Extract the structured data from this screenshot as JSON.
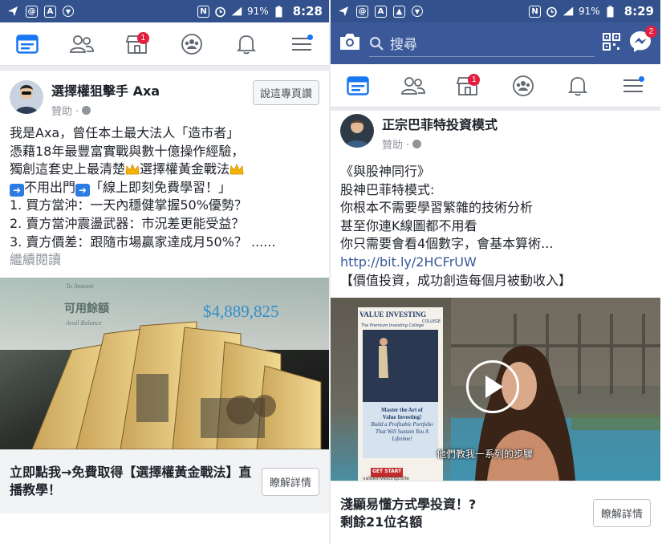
{
  "left": {
    "status": {
      "time": "8:28",
      "battery": "91%",
      "network": "4G"
    },
    "nav": {
      "notifications_badge": "1"
    },
    "post": {
      "page_name": "選擇權狙擊手 Axa",
      "sponsored": "贊助 · ",
      "like_button": "說這專頁讚",
      "lines": [
        "我是Axa，曾任本土最大法人「造市者」",
        "憑藉18年最豐富實戰與數十億操作經驗，",
        "獨創這套史上最清楚",
        "選擇權黃金戰法",
        "不用出門",
        "「線上即刻免費學習！」",
        "1. 買方當沖：一天內穩健掌握50%優勢？",
        "2. 賣方當沖震盪武器：市況差更能受益？",
        "3. 賣方價差：跟隨市場贏家達成月50%？ ......",
        "繼續閱讀"
      ],
      "image_price": "$4,889,825",
      "image_label": "可用餘額",
      "image_top_label": "To Amount",
      "image_sub_label": "Avail Balance",
      "cta_title": "立即點我→免費取得【選擇權黃金戰法】直播教學！",
      "cta_button": "瞭解詳情"
    }
  },
  "right": {
    "status": {
      "time": "8:29",
      "battery": "91%",
      "network": "4G"
    },
    "search": {
      "placeholder": "搜尋",
      "messenger_badge": "2"
    },
    "nav": {
      "notifications_badge": "1"
    },
    "post": {
      "page_name": "正宗巴菲特投資模式",
      "sponsored": "贊助 · ",
      "lines": [
        "《與股神同行》",
        "股神巴菲特模式:",
        "你根本不需要學習繁雜的技術分析",
        "甚至你連K線圖都不用看",
        "你只需要會看4個數字，會基本算術...",
        "http://bit.ly/2HCFrUW",
        "【價值投資，成功創造每個月被動收入】"
      ],
      "video": {
        "banner_title": "VALUE INVESTING",
        "banner_sub": "COLLEGE",
        "banner_tag": "The Premium Investing College",
        "poster_line1": "Master the Art of",
        "poster_line2": "Value Investing!",
        "poster_line3": "Build a Profitable Portfolio",
        "poster_line4": "That Will Sustain You A",
        "poster_line5": "Lifetime!",
        "poster_get": "GET START",
        "poster_url": "valueinvestingcolle",
        "subtitle": "他們教我一系列的步驟"
      },
      "cta_title_1": "淺顯易懂方式學投資！?",
      "cta_title_2": "剩餘21位名額",
      "cta_button": "瞭解詳情"
    }
  },
  "colors": {
    "statusbar": "#33528d",
    "searchbar": "#3b5998",
    "badge": "#e41e3f",
    "link": "#385898"
  }
}
